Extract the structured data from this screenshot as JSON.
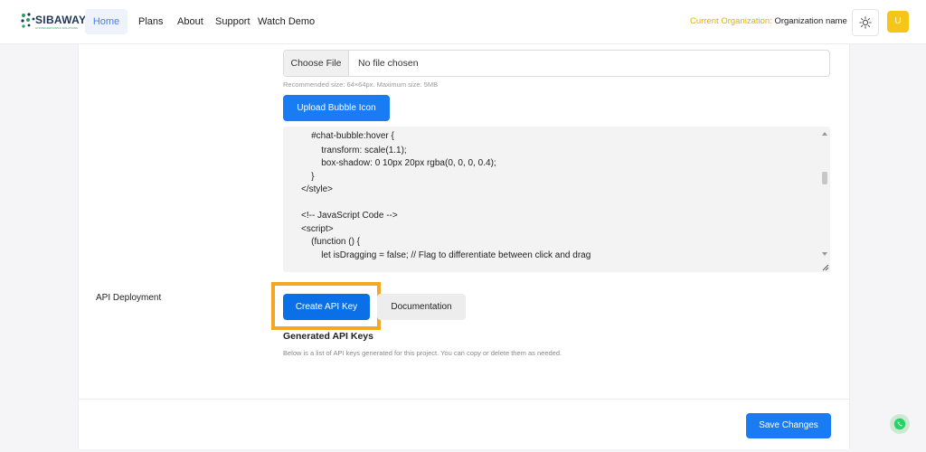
{
  "navbar": {
    "logo_text": "SIBAWAY",
    "logo_tagline": "AI INTEGRATIONS & SOLUTIONS",
    "links": [
      "Home",
      "Plans",
      "About",
      "Support",
      "Watch Demo"
    ],
    "org_label": "Current Organization:",
    "org_name": "Organization name",
    "avatar_letter": "U"
  },
  "upload": {
    "choose_file_label": "Choose File",
    "file_status": "No file chosen",
    "hint": "Recommended size: 64×64px. Maximum size: 5MB",
    "upload_button": "Upload Bubble Icon"
  },
  "code_lines": [
    "    #chat-bubble:hover {",
    "        transform: scale(1.1);",
    "        box-shadow: 0 10px 20px rgba(0, 0, 0, 0.4);",
    "    }",
    "</style>",
    "",
    "<!-- JavaScript Code -->",
    "<script>",
    "    (function () {",
    "        let isDragging = false; // Flag to differentiate between click and drag"
  ],
  "api": {
    "section_label": "API Deployment",
    "create_button": "Create API Key",
    "documentation_button": "Documentation",
    "generated_title": "Generated API Keys",
    "generated_desc": "Below is a list of API keys generated for this project. You can copy or delete them as needed."
  },
  "footer": {
    "save_button": "Save Changes"
  },
  "colors": {
    "primary": "#1a7cf5",
    "highlight": "#f5a623",
    "org_label": "#e0b100",
    "avatar": "#f5c518"
  }
}
